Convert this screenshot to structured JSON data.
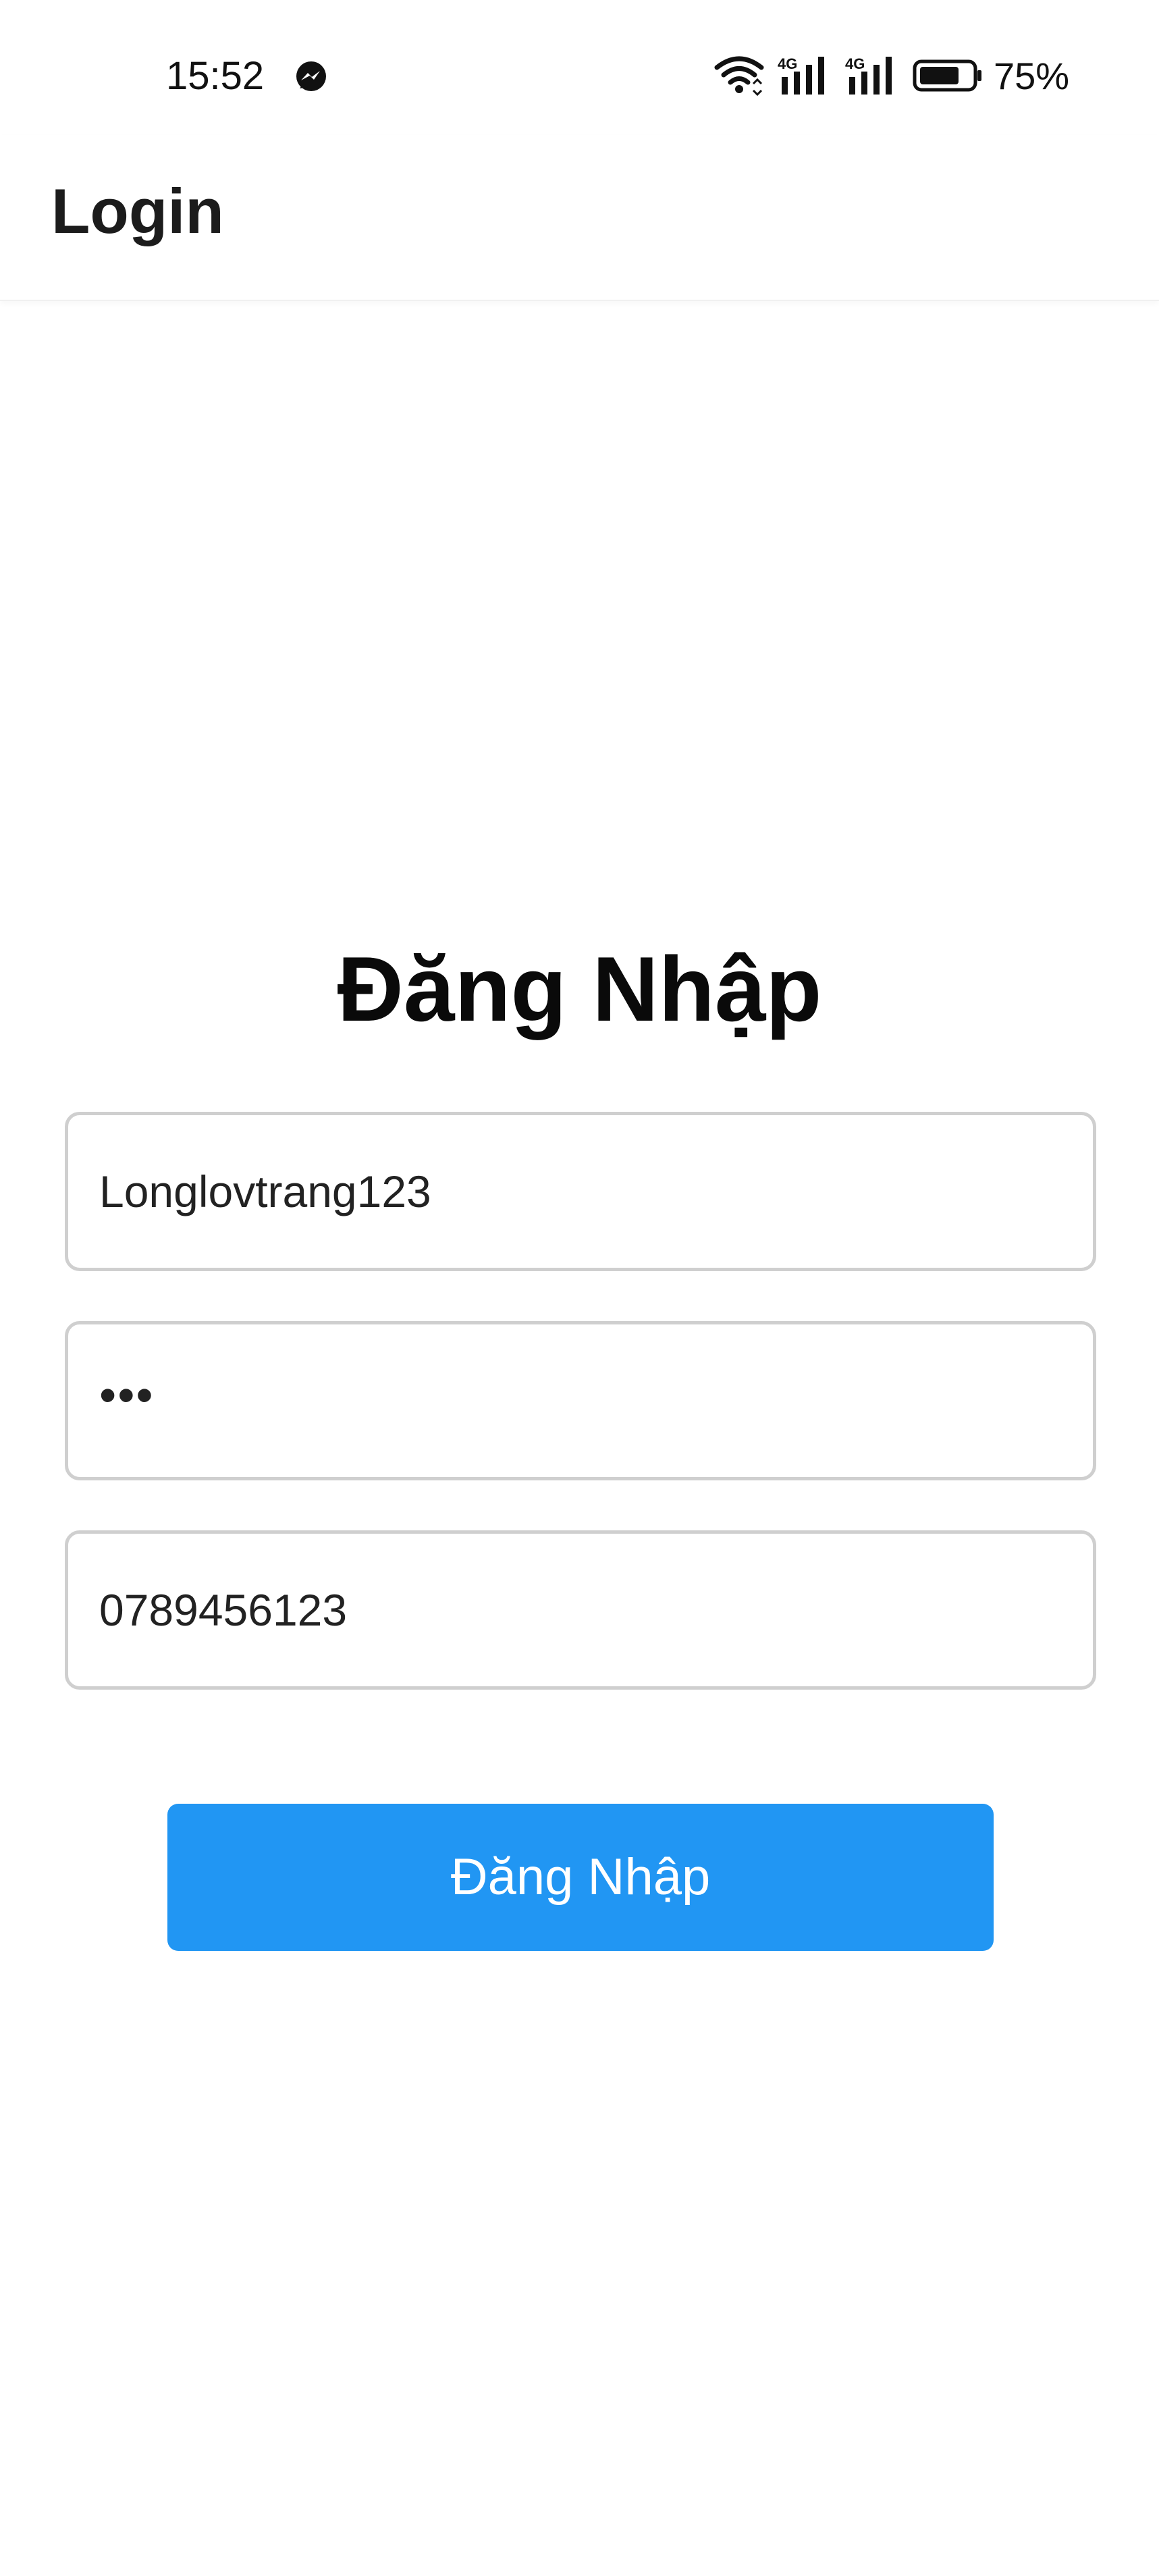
{
  "status_bar": {
    "time": "15:52",
    "battery_percent": "75%",
    "icons": [
      "messenger-icon",
      "wifi-icon",
      "signal-4g-icon",
      "signal-4g-icon",
      "battery-icon"
    ],
    "battery_level": 0.75
  },
  "app_bar": {
    "title": "Login"
  },
  "form": {
    "heading": "Đăng Nhập",
    "username_value": "Longlovtrang123",
    "password_value": "•••",
    "phone_value": "0789456123",
    "submit_label": "Đăng Nhập"
  },
  "colors": {
    "accent": "#2196f3",
    "input_border": "#cfcfcf",
    "background": "#ffffff"
  }
}
